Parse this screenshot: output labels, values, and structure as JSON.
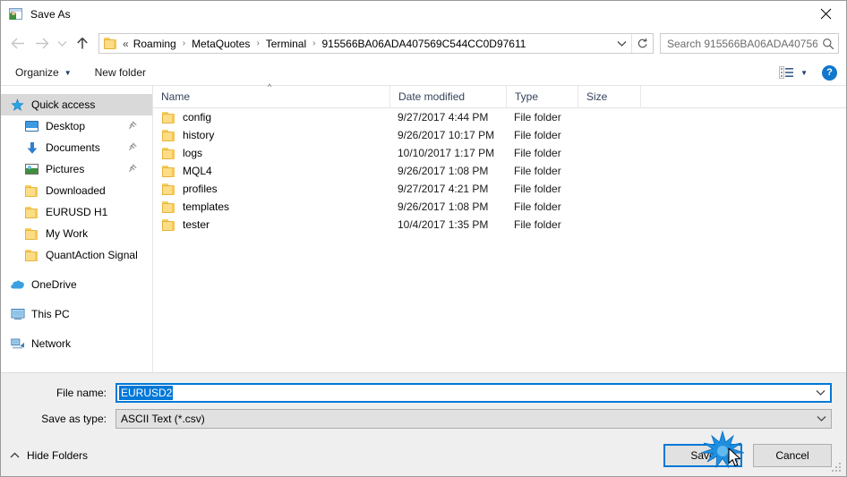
{
  "window": {
    "title": "Save As",
    "icon": "save-as-icon",
    "close_label": "✕"
  },
  "nav": {
    "back": "back-arrow",
    "forward": "forward-arrow",
    "recent": "recent-locations-chevron",
    "up": "up-arrow",
    "breadcrumb": {
      "overflow": "«",
      "items": [
        "Roaming",
        "MetaQuotes",
        "Terminal",
        "915566BA06ADA407569C544CC0D97611"
      ],
      "separator": "›"
    },
    "address_dropdown": "chevron-down-icon",
    "refresh": "↻"
  },
  "search": {
    "placeholder": "Search 915566BA06ADA40756...",
    "icon": "search-icon"
  },
  "toolbar": {
    "organize": "Organize",
    "organize_caret": "▼",
    "new_folder": "New folder",
    "view_caret": "▼",
    "help": "?"
  },
  "sidebar": {
    "groups": [
      {
        "header": {
          "label": "Quick access",
          "icon": "star-icon",
          "selected": true
        },
        "items": [
          {
            "label": "Desktop",
            "icon": "monitor-icon",
            "pinned": true
          },
          {
            "label": "Documents",
            "icon": "download-arrow-icon",
            "pinned": true
          },
          {
            "label": "Pictures",
            "icon": "picture-icon",
            "pinned": true
          },
          {
            "label": "Downloaded",
            "icon": "folder-icon",
            "pinned": false
          },
          {
            "label": "EURUSD H1",
            "icon": "folder-icon",
            "pinned": false
          },
          {
            "label": "My Work",
            "icon": "folder-icon",
            "pinned": false
          },
          {
            "label": "QuantAction Signal",
            "icon": "folder-icon",
            "pinned": false
          }
        ]
      }
    ],
    "roots": [
      {
        "label": "OneDrive",
        "icon": "cloud-icon"
      },
      {
        "label": "This PC",
        "icon": "computer-icon"
      },
      {
        "label": "Network",
        "icon": "network-icon"
      }
    ]
  },
  "filelist": {
    "columns": [
      "Name",
      "Date modified",
      "Type",
      "Size"
    ],
    "sort_indicator": "^",
    "rows": [
      {
        "name": "config",
        "date": "9/27/2017 4:44 PM",
        "type": "File folder",
        "size": ""
      },
      {
        "name": "history",
        "date": "9/26/2017 10:17 PM",
        "type": "File folder",
        "size": ""
      },
      {
        "name": "logs",
        "date": "10/10/2017 1:17 PM",
        "type": "File folder",
        "size": ""
      },
      {
        "name": "MQL4",
        "date": "9/26/2017 1:08 PM",
        "type": "File folder",
        "size": ""
      },
      {
        "name": "profiles",
        "date": "9/27/2017 4:21 PM",
        "type": "File folder",
        "size": ""
      },
      {
        "name": "templates",
        "date": "9/26/2017 1:08 PM",
        "type": "File folder",
        "size": ""
      },
      {
        "name": "tester",
        "date": "10/4/2017 1:35 PM",
        "type": "File folder",
        "size": ""
      }
    ]
  },
  "form": {
    "filename_label": "File name:",
    "filename_value": "EURUSD2",
    "filetype_label": "Save as type:",
    "filetype_value": "ASCII Text (*.csv)",
    "dropdown_icon": "chevron-down-icon"
  },
  "footer": {
    "hide_folders": "Hide Folders",
    "hide_caret": "^",
    "save": "Save",
    "cancel": "Cancel"
  },
  "colors": {
    "accent": "#0078d7",
    "selection": "#0078d7",
    "sidebar_selection": "#d9d9d9",
    "folder": "#fcdd86",
    "help_blue": "#1177cc",
    "form_bg": "#efefef"
  }
}
